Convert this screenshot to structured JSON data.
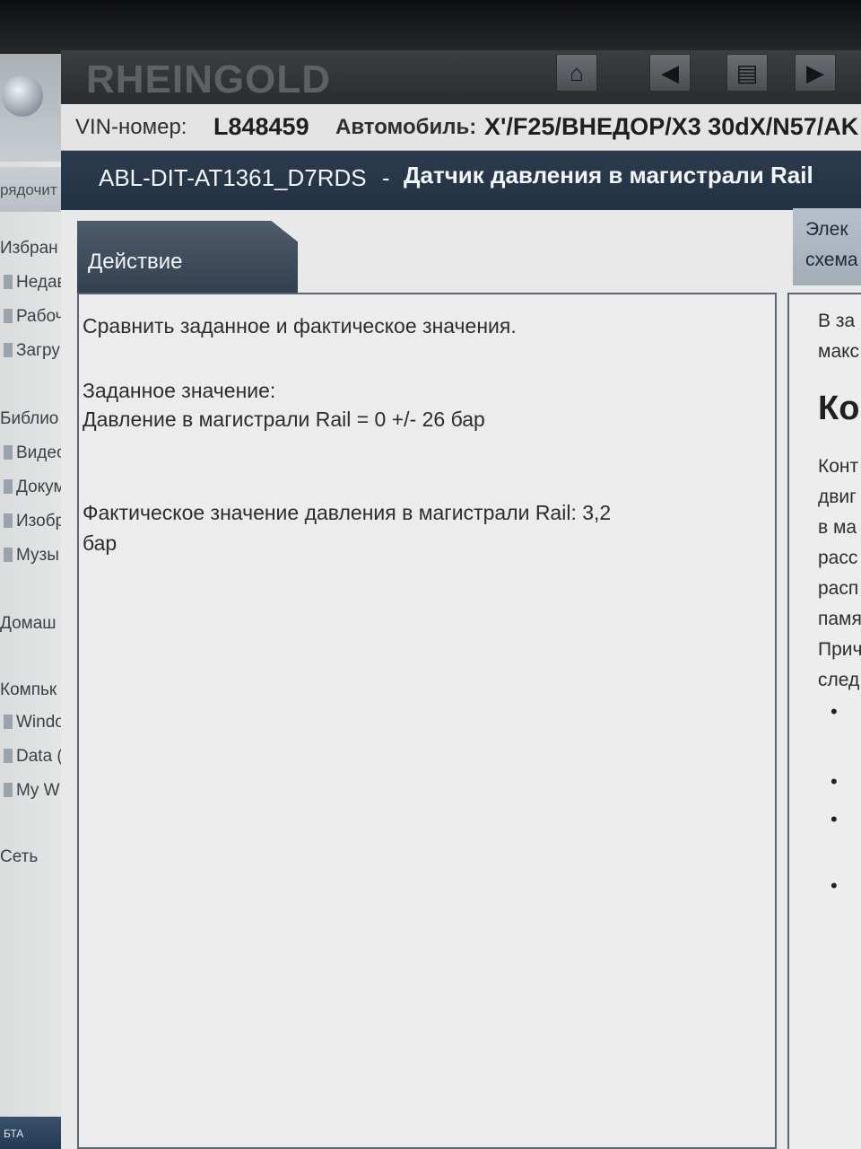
{
  "explorer": {
    "toolbar_label": "рядочит",
    "nav": [
      {
        "label": "Избран",
        "kind": "hdr"
      },
      {
        "label": "Недав",
        "kind": "sub"
      },
      {
        "label": "Рабоч",
        "kind": "sub"
      },
      {
        "label": "Загру",
        "kind": "sub"
      },
      {
        "label": "Библио",
        "kind": "hdr"
      },
      {
        "label": "Видео",
        "kind": "sub"
      },
      {
        "label": "Докум",
        "kind": "sub"
      },
      {
        "label": "Изобр",
        "kind": "sub"
      },
      {
        "label": "Музы",
        "kind": "sub"
      },
      {
        "label": "Домаш",
        "kind": "hdr"
      },
      {
        "label": "Компьк",
        "kind": "hdr"
      },
      {
        "label": "Windo",
        "kind": "sub"
      },
      {
        "label": "Data (",
        "kind": "sub"
      },
      {
        "label": "My W",
        "kind": "sub"
      },
      {
        "label": "Сеть",
        "kind": "hdr"
      }
    ],
    "footer": "БТА"
  },
  "app": {
    "brand": "RHEINGOLD",
    "toolbar_icons": [
      "home-icon",
      "back-icon",
      "documents-icon",
      "forward-icon"
    ],
    "vehicle": {
      "vin_label": "VIN-номер:",
      "vin_value": "L848459",
      "car_label": "Автомобиль:",
      "car_value": "X'/F25/ВНЕДОР/X3 30dX/N57/AK"
    },
    "test": {
      "code": "ABL-DIT-AT1361_D7RDS",
      "separator": "-",
      "title": "Датчик давления в магистрали Rail"
    },
    "tabs": {
      "action": "Действие",
      "right_line1": "Элек",
      "right_line2": "схема"
    },
    "left_panel": {
      "instruction": "Сравнить заданное и фактическое значения.",
      "setpoint_label": "Заданное значение:",
      "setpoint_value": "Давление в магистрали Rail = 0 +/- 26 бар",
      "actual_line1": "Фактическое значение давления в магистрали Rail: 3,2",
      "actual_line2": "бар"
    },
    "right_panel": {
      "lines_top": [
        "В за",
        "макс"
      ],
      "heading": "Ко",
      "lines": [
        "Конт",
        "двиг",
        "в ма",
        "расс",
        "расп",
        "памя",
        "Прич",
        "след"
      ],
      "bullet_glyph": "•"
    }
  }
}
